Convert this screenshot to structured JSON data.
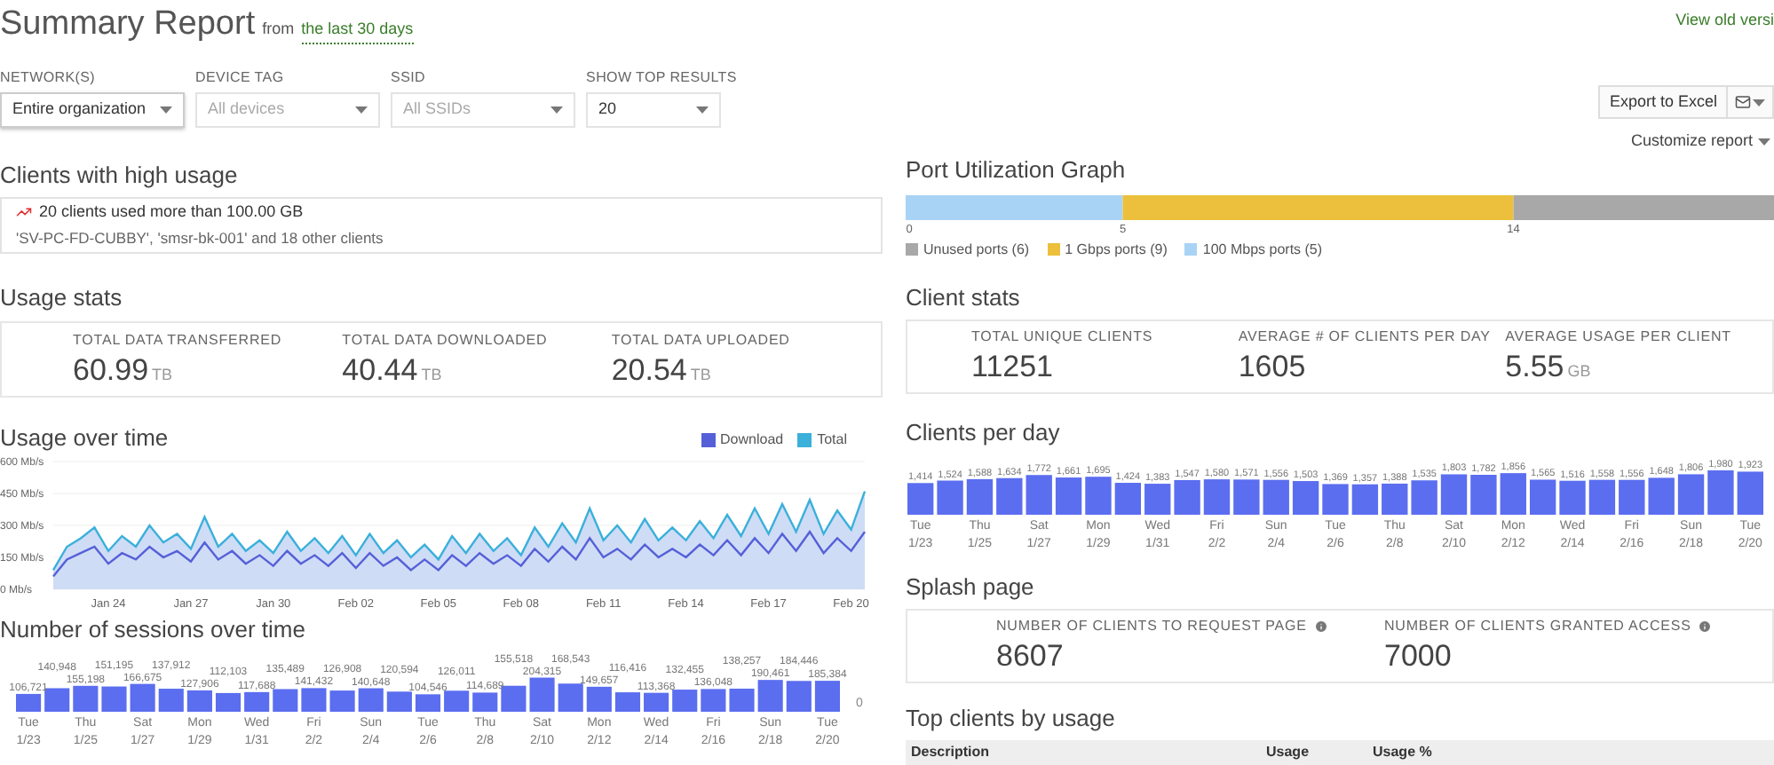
{
  "header": {
    "title": "Summary Report",
    "from_label": "from",
    "period_link": "the last 30 days",
    "view_old_link": "View old versi"
  },
  "filters": [
    {
      "label": "NETWORK(S)",
      "kind": "button",
      "value": "Entire organization"
    },
    {
      "label": "DEVICE TAG",
      "kind": "select",
      "placeholder": "All devices"
    },
    {
      "label": "SSID",
      "kind": "select",
      "placeholder": "All SSIDs"
    },
    {
      "label": "SHOW TOP RESULTS",
      "kind": "select",
      "value": "20"
    }
  ],
  "actions": {
    "export_button": "Export to Excel",
    "customize_link": "Customize report"
  },
  "high_usage": {
    "title": "Clients with high usage",
    "headline": "20 clients used more than 100.00 GB",
    "details": "'SV-PC-FD-CUBBY', 'smsr-bk-001' and 18 other clients"
  },
  "usage_stats": {
    "title": "Usage stats",
    "stats": [
      {
        "label": "TOTAL DATA TRANSFERRED",
        "value": "60.99",
        "unit": "TB"
      },
      {
        "label": "TOTAL DATA DOWNLOADED",
        "value": "40.44",
        "unit": "TB"
      },
      {
        "label": "TOTAL DATA UPLOADED",
        "value": "20.54",
        "unit": "TB"
      }
    ]
  },
  "usage_over_time": {
    "title": "Usage over time",
    "chart_data": {
      "type": "line",
      "legend": "top-right",
      "grid": true,
      "ylim": [
        0,
        600
      ],
      "categories": [
        null,
        null,
        null,
        null,
        "Jan 24",
        null,
        null,
        null,
        null,
        null,
        "Jan 27",
        null,
        null,
        null,
        null,
        null,
        "Jan 30",
        null,
        null,
        null,
        null,
        null,
        "Feb 02",
        null,
        null,
        null,
        null,
        null,
        "Feb 05",
        null,
        null,
        null,
        null,
        null,
        "Feb 08",
        null,
        null,
        null,
        null,
        null,
        "Feb 11",
        null,
        null,
        null,
        null,
        null,
        "Feb 14",
        null,
        null,
        null,
        null,
        null,
        "Feb 17",
        null,
        null,
        null,
        null,
        null,
        "Feb 20",
        null
      ],
      "yticks": [
        {
          "value": 0,
          "label": "0 Mb/s"
        },
        {
          "value": 150,
          "label": "150 Mb/s"
        },
        {
          "value": 300,
          "label": "300 Mb/s"
        },
        {
          "value": 450,
          "label": "450 Mb/s"
        },
        {
          "value": 600,
          "label": "600 Mb/s"
        }
      ],
      "series": [
        {
          "name": "Download",
          "color": "#5560d8",
          "values": [
            60,
            140,
            170,
            200,
            120,
            170,
            140,
            200,
            150,
            180,
            130,
            220,
            140,
            180,
            120,
            160,
            110,
            180,
            120,
            160,
            110,
            170,
            100,
            170,
            110,
            150,
            90,
            140,
            90,
            160,
            110,
            170,
            120,
            160,
            110,
            190,
            130,
            200,
            140,
            240,
            150,
            190,
            140,
            210,
            150,
            190,
            150,
            210,
            160,
            230,
            160,
            240,
            170,
            260,
            180,
            270,
            170,
            240,
            180,
            270
          ]
        },
        {
          "name": "Total",
          "type": "area",
          "color": "#3ab0da",
          "values": [
            90,
            200,
            240,
            290,
            180,
            250,
            200,
            300,
            220,
            260,
            190,
            340,
            200,
            260,
            180,
            230,
            170,
            270,
            180,
            240,
            170,
            250,
            160,
            260,
            170,
            230,
            150,
            210,
            140,
            250,
            170,
            260,
            180,
            240,
            160,
            290,
            200,
            310,
            220,
            380,
            230,
            300,
            220,
            330,
            230,
            290,
            230,
            320,
            240,
            350,
            250,
            380,
            260,
            400,
            270,
            420,
            260,
            370,
            280,
            460
          ]
        }
      ]
    }
  },
  "sessions": {
    "title": "Number of sessions over time",
    "chart_data": {
      "type": "bar",
      "annotations": [
        {
          "text": "0"
        }
      ],
      "categories": [
        "Tue 1/23",
        null,
        "Thu 1/25",
        null,
        "Sat 1/27",
        null,
        "Mon 1/29",
        null,
        "Wed 1/31",
        null,
        "Fri 2/2",
        null,
        "Sun 2/4",
        null,
        "Tue 2/6",
        null,
        "Thu 2/8",
        null,
        "Sat 2/10",
        null,
        "Mon 2/12",
        null,
        "Wed 2/14",
        null,
        "Fri 2/16",
        null,
        "Sun 2/18",
        null,
        "Tue 2/20"
      ],
      "data_labels": true,
      "series": [
        {
          "color": "#5b6ef0",
          "values": [
            106721,
            140948,
            155198,
            151195,
            166675,
            137912,
            127906,
            112103,
            117688,
            135489,
            141432,
            126908,
            140648,
            120594,
            104546,
            126011,
            114689,
            155518,
            204315,
            168543,
            149657,
            116416,
            113368,
            132455,
            136048,
            138257,
            190461,
            184446,
            185384
          ],
          "value_labels": [
            "106,721",
            "140,948",
            "155,198",
            "151,195",
            "166,675",
            "137,912",
            "127,906",
            "112,103",
            "117,688",
            "135,489",
            "141,432",
            "126,908",
            "140,648",
            "120,594",
            "104,546",
            "126,011",
            "114,689",
            "155,518",
            "204,315",
            "168,543",
            "149,657",
            "116,416",
            "113,368",
            "132,455",
            "136,048",
            "138,257",
            "190,461",
            "184,446",
            "185,384"
          ]
        }
      ]
    }
  },
  "port_utilization": {
    "title": "Port Utilization Graph",
    "chart_data": {
      "type": "bar",
      "orientation": "horizontal",
      "stacked": true,
      "legend": "bottom",
      "xlim": [
        0,
        20
      ],
      "xticks": [
        0,
        5,
        14
      ],
      "series": [
        {
          "name": "100 Mbps ports (5)",
          "color": "#a9d3f5",
          "values": [
            5
          ]
        },
        {
          "name": "1 Gbps ports (9)",
          "color": "#ecc03c",
          "values": [
            9
          ]
        },
        {
          "name": "Unused ports (6)",
          "color": "#a8a8a8",
          "values": [
            6
          ]
        }
      ]
    }
  },
  "client_stats": {
    "title": "Client stats",
    "stats": [
      {
        "label": "TOTAL UNIQUE CLIENTS",
        "value": "11251"
      },
      {
        "label": "AVERAGE # OF CLIENTS PER DAY",
        "value": "1605"
      },
      {
        "label": "AVERAGE USAGE PER CLIENT",
        "value": "5.55",
        "unit": "GB"
      }
    ]
  },
  "clients_per_day": {
    "title": "Clients per day",
    "chart_data": {
      "type": "bar",
      "categories": [
        "Tue 1/23",
        null,
        "Thu 1/25",
        null,
        "Sat 1/27",
        null,
        "Mon 1/29",
        null,
        "Wed 1/31",
        null,
        "Fri 2/2",
        null,
        "Sun 2/4",
        null,
        "Tue 2/6",
        null,
        "Thu 2/8",
        null,
        "Sat 2/10",
        null,
        "Mon 2/12",
        null,
        "Wed 2/14",
        null,
        "Fri 2/16",
        null,
        "Sun 2/18",
        null,
        "Tue 2/20"
      ],
      "data_labels": true,
      "series": [
        {
          "color": "#5b6ef0",
          "values": [
            1414,
            1524,
            1588,
            1634,
            1772,
            1661,
            1695,
            1424,
            1383,
            1547,
            1580,
            1571,
            1556,
            1503,
            1369,
            1357,
            1388,
            1535,
            1803,
            1782,
            1856,
            1565,
            1516,
            1558,
            1556,
            1648,
            1806,
            1980,
            1923
          ],
          "value_labels": [
            "1,414",
            "1,524",
            "1,588",
            "1,634",
            "1,772",
            "1,661",
            "1,695",
            "1,424",
            "1,383",
            "1,547",
            "1,580",
            "1,571",
            "1,556",
            "1,503",
            "1,369",
            "1,357",
            "1,388",
            "1,535",
            "1,803",
            "1,782",
            "1,856",
            "1,565",
            "1,516",
            "1,558",
            "1,556",
            "1,648",
            "1,806",
            "1,980",
            "1,923"
          ]
        }
      ]
    }
  },
  "splash_page": {
    "title": "Splash page",
    "stats": [
      {
        "label": "NUMBER OF CLIENTS TO REQUEST PAGE",
        "value": "8607"
      },
      {
        "label": "NUMBER OF CLIENTS GRANTED ACCESS",
        "value": "7000"
      }
    ]
  },
  "top_clients": {
    "title": "Top clients by usage",
    "columns": [
      "Description",
      "Usage",
      "Usage %"
    ]
  }
}
